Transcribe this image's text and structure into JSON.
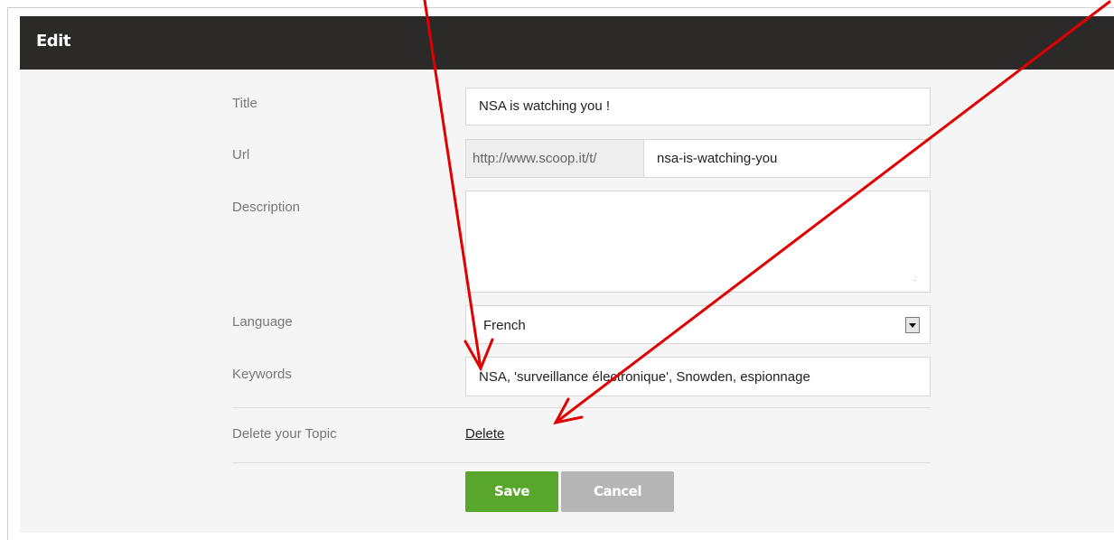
{
  "header": {
    "title": "Edit"
  },
  "form": {
    "title_label": "Title",
    "title_value": "NSA is watching you !",
    "url_label": "Url",
    "url_prefix": "http://www.scoop.it/t/",
    "url_slug": "nsa-is-watching-you",
    "description_label": "Description",
    "description_value": "",
    "language_label": "Language",
    "language_value": "French",
    "keywords_label": "Keywords",
    "keywords_value": "NSA, 'surveillance électronique', Snowden, espionnage",
    "delete_label": "Delete your Topic",
    "delete_link": "Delete"
  },
  "buttons": {
    "save": "Save",
    "cancel": "Cancel"
  },
  "colors": {
    "header_bg": "#2b2a29",
    "save_bg": "#59a62c",
    "cancel_bg": "#b5b5b5",
    "annotation_arrow": "#e00000"
  },
  "icons": {
    "select_arrow": "chevron-down-icon",
    "resize_grip": "resize-grip-icon"
  }
}
